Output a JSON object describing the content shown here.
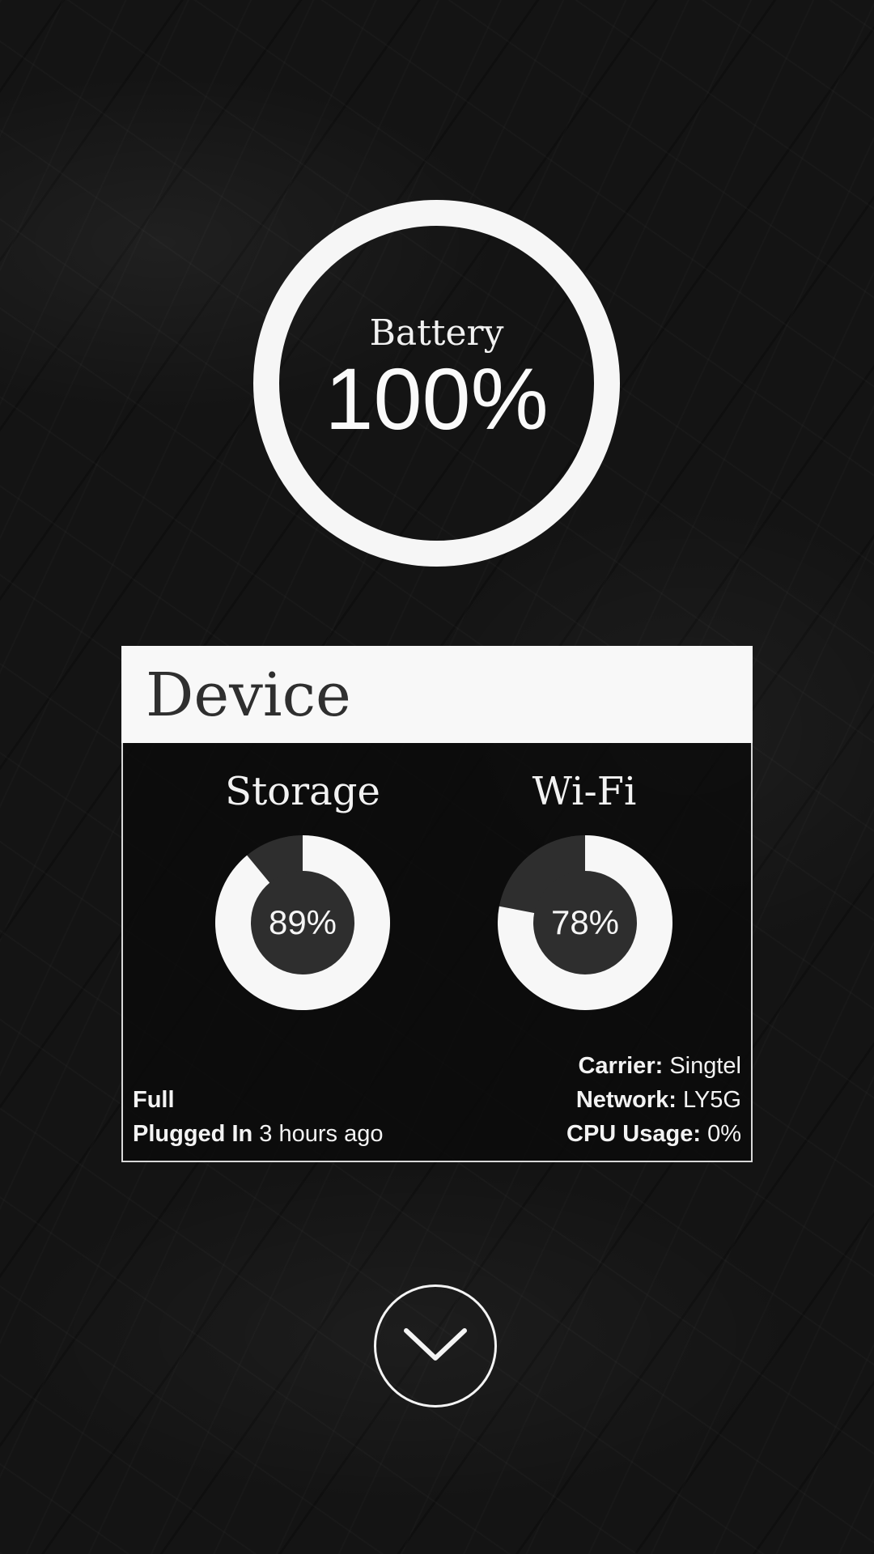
{
  "battery": {
    "label": "Battery",
    "value": "100%",
    "level": 100
  },
  "device_card": {
    "title": "Device",
    "storage": {
      "label": "Storage",
      "value": "89%",
      "level": 89
    },
    "wifi": {
      "label": "Wi-Fi",
      "value": "78%",
      "level": 78
    },
    "status": "Full",
    "plugged_label": "Plugged In",
    "plugged_value": "3 hours ago",
    "carrier_label": "Carrier:",
    "carrier_value": "Singtel",
    "network_label": "Network:",
    "network_value": "LY5G",
    "cpu_label": "CPU Usage:",
    "cpu_value": "0%"
  },
  "scroll_icon": "chevron-down-icon",
  "colors": {
    "ring": "#f6f6f6",
    "gauge_track": "#2e2e2e",
    "card_header": "#f8f8f8"
  }
}
